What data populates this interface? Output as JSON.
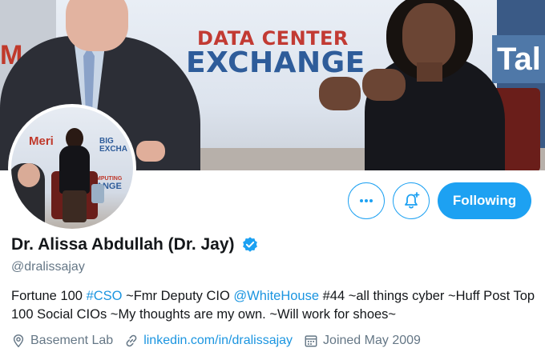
{
  "banner": {
    "sign_line1": "DATA CENTER",
    "sign_line2": "EXCHANGE",
    "left_sign_fragment": "M",
    "right_sign_fragment": "Tal"
  },
  "avatar": {
    "sign_left": "Meri",
    "sign_right_1": "BIG",
    "sign_right_2": "EXCHA",
    "sign_bottom_1": "MPUTING",
    "sign_bottom_2": "ANGE"
  },
  "actions": {
    "more_icon": "more-dots-icon",
    "notify_icon": "bell-plus-icon",
    "follow_label": "Following",
    "accent": "#1da1f2"
  },
  "profile": {
    "name": "Dr. Alissa Abdullah (Dr. Jay)",
    "handle": "@dralissajay",
    "verified_icon": "verified-badge-icon",
    "bio": {
      "t1": "Fortune 100 ",
      "hashtag": "#CSO",
      "t2": " ~Fmr Deputy CIO ",
      "mention": "@WhiteHouse",
      "t3": " #44 ~all things cyber ~Huff Post Top 100 Social CIOs ~My thoughts are my own. ~Will work for shoes~"
    },
    "location": "Basement Lab",
    "website": "linkedin.com/in/dralissajay",
    "joined": "Joined May 2009"
  }
}
